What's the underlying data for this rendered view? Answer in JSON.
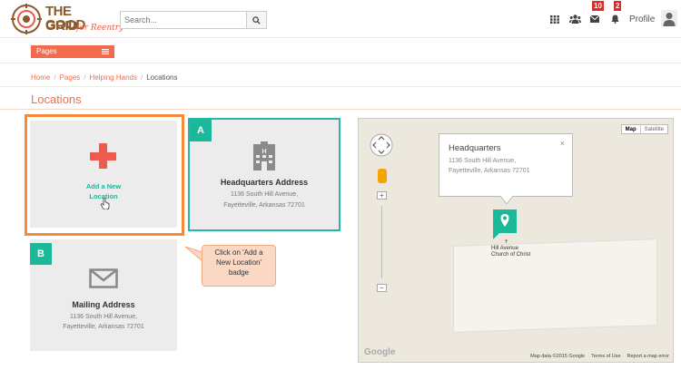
{
  "header": {
    "logo": {
      "line1": "THE GOOD",
      "line2": "GRID",
      "tagline": "for Reentry"
    },
    "search": {
      "placeholder": "Search..."
    },
    "icons": [
      "grid-icon",
      "users-icon",
      "envelope-icon",
      "bell-icon"
    ],
    "messages_count": "10",
    "notifications_count": "2",
    "profile_label": "Profile"
  },
  "pagesbar": {
    "label": "Pages"
  },
  "breadcrumb": {
    "home": "Home",
    "pages": "Pages",
    "helping_hands": "Helping Hands",
    "current": "Locations"
  },
  "page": {
    "title": "Locations"
  },
  "add_card": {
    "label_line1": "Add a New",
    "label_line2": "Location"
  },
  "hq_card": {
    "letter": "A",
    "title": "Headquarters Address",
    "addr1": "1136 South Hill Avenue,",
    "addr2": "Fayetteville, Arkansas 72701"
  },
  "mail_card": {
    "letter": "B",
    "title": "Mailing Address",
    "addr1": "1136 South Hill Avenue,",
    "addr2": "Fayetteville, Arkansas 72701"
  },
  "callout": {
    "line1": "Click on 'Add a",
    "line2": "New Location'",
    "line3": "badge"
  },
  "map": {
    "type_map": "Map",
    "type_satellite": "Satellite",
    "popup_title": "Headquarters",
    "popup_addr1": "1136 South Hill Avenue,",
    "popup_addr2": "Fayetteville, Arkansas 72701",
    "popup_close": "×",
    "church_line1": "Hill Avenue",
    "church_line2": "Church of Christ",
    "google": "Google",
    "attrib_data": "Map data ©2015 Google",
    "attrib_terms": "Terms of Use",
    "attrib_report": "Report a map error",
    "zoom_in": "+",
    "zoom_out": "−"
  },
  "colors": {
    "accent": "#f36b4c",
    "teal": "#1bb99a",
    "highlight": "#f58a3c"
  }
}
